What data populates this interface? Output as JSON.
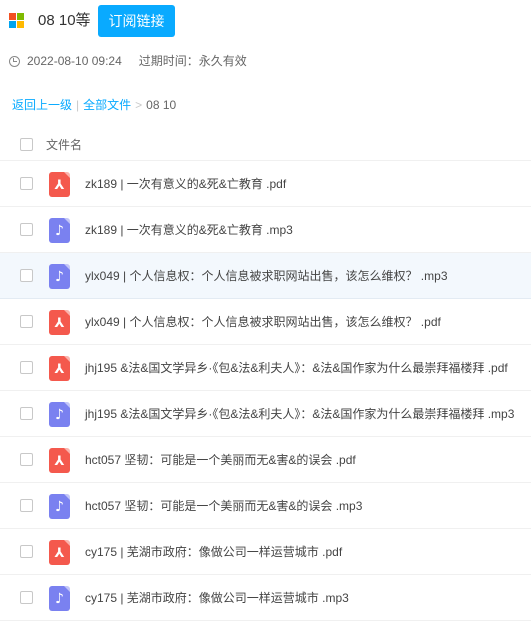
{
  "header": {
    "title": "08 10等",
    "subscribe_label": "订阅链接"
  },
  "meta": {
    "datetime": "2022-08-10 09:24",
    "expire_label": "过期时间：永久有效"
  },
  "breadcrumb": {
    "back": "返回上一级",
    "all_files": "全部文件",
    "current": "08 10",
    "separator_bar": "|",
    "separator_arrow": ">"
  },
  "list": {
    "column_label": "文件名",
    "files": [
      {
        "name": "zk189 | 一次有意义的&死&亡教育 .pdf",
        "type": "pdf",
        "icon": "pdf-icon"
      },
      {
        "name": "zk189 | 一次有意义的&死&亡教育 .mp3",
        "type": "mp3",
        "icon": "music-icon"
      },
      {
        "name": "ylx049 | 个人信息权：个人信息被求职网站出售，该怎么维权？ .mp3",
        "type": "mp3",
        "icon": "music-icon"
      },
      {
        "name": "ylx049 | 个人信息权：个人信息被求职网站出售，该怎么维权？  .pdf",
        "type": "pdf",
        "icon": "pdf-icon"
      },
      {
        "name": "jhj195 &法&国文学异乡·《包&法&利夫人》：&法&国作家为什么最崇拜福楼拜 .pdf",
        "type": "pdf",
        "icon": "pdf-icon"
      },
      {
        "name": "jhj195 &法&国文学异乡·《包&法&利夫人》：&法&国作家为什么最崇拜福楼拜 .mp3",
        "type": "mp3",
        "icon": "music-icon"
      },
      {
        "name": "hct057 坚韧：可能是一个美丽而无&害&的误会 .pdf",
        "type": "pdf",
        "icon": "pdf-icon"
      },
      {
        "name": "hct057 坚韧：可能是一个美丽而无&害&的误会 .mp3",
        "type": "mp3",
        "icon": "music-icon"
      },
      {
        "name": "cy175  |  芜湖市政府：像做公司一样运营城市 .pdf",
        "type": "pdf",
        "icon": "pdf-icon"
      },
      {
        "name": "cy175  |  芜湖市政府：像做公司一样运营城市 .mp3",
        "type": "mp3",
        "icon": "music-icon"
      }
    ]
  },
  "colors": {
    "accent": "#09aaff",
    "pdf": "#f4594d",
    "mp3": "#7a81f0",
    "hover_row": "#f3f8fd"
  }
}
